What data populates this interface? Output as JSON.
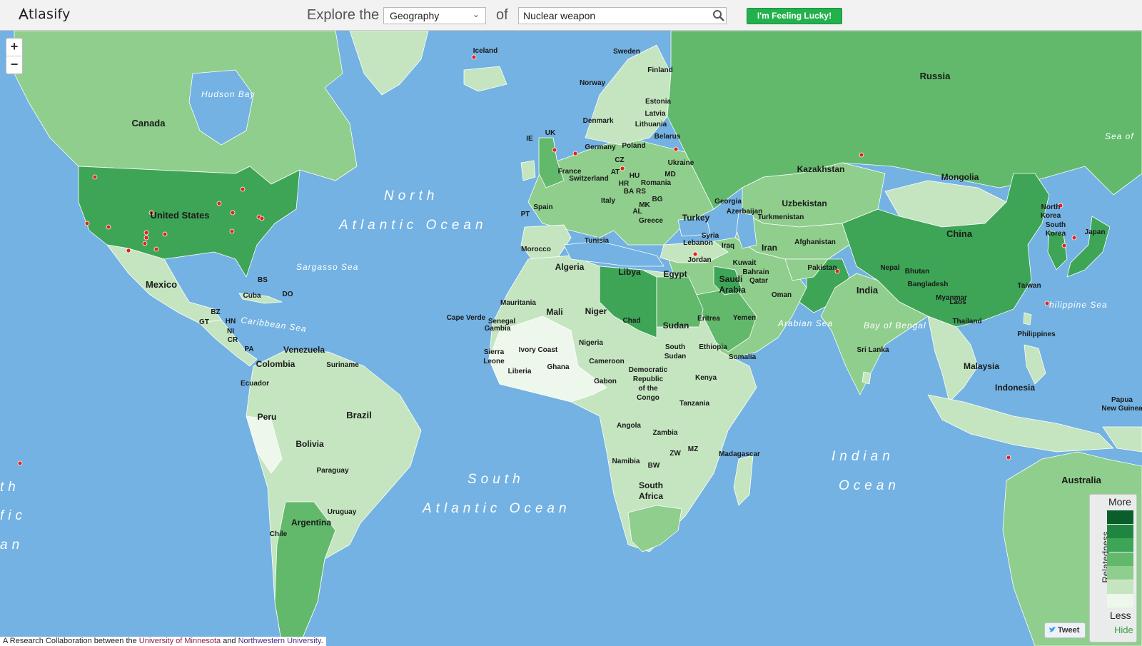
{
  "app": {
    "logo_text": "tlasify"
  },
  "header": {
    "explore_label": "Explore the",
    "category_selected": "Geography",
    "of_label": "of",
    "search_value": "Nuclear weapon",
    "lucky_label": "I'm Feeling Lucky!"
  },
  "zoom": {
    "in_label": "+",
    "out_label": "−"
  },
  "legend": {
    "more_label": "More",
    "less_label": "Less",
    "title": "Relatedness",
    "hide_label": "Hide",
    "colors": [
      "#0b5e2b",
      "#1f8641",
      "#3ea557",
      "#62b96c",
      "#8fce8c",
      "#c4e5c0",
      "#eef7ec"
    ]
  },
  "tweet": {
    "label": "Tweet"
  },
  "footer": {
    "prefix": "A Research Collaboration between the",
    "umn": "University of Minnesota",
    "and": "and",
    "nwu": "Northwestern University",
    "suffix": "."
  },
  "map": {
    "ocean_color": "#73b2e2",
    "oceans": {
      "north1": "North",
      "north2": "Atlantic Ocean",
      "south1": "South",
      "south2": "Atlantic Ocean",
      "indian1": "Indian",
      "indian2": "Ocean",
      "pac1": "th",
      "pac2": "fic",
      "pac3": "an",
      "hudson": "Hudson Bay",
      "sargasso": "Sargasso Sea",
      "caribbean": "Caribbean Sea",
      "arabian": "Arabian Sea",
      "bengal": "Bay of Bengal",
      "philippine": "hilippine Sea",
      "okhotsk": "Sea of"
    },
    "countries": {
      "canada": "Canada",
      "us": "United States",
      "mexico": "Mexico",
      "russia": "Russia",
      "china": "China",
      "mongolia": "Mongolia",
      "kazakhstan": "Kazakhstan",
      "uzbekistan": "Uzbekistan",
      "turkmenistan": "Turkmenistan",
      "afghanistan": "Afghanistan",
      "pakistan": "Pakistan",
      "iran": "Iran",
      "iraq": "Iraq",
      "syria": "Syria",
      "lebanon": "Lebanon",
      "jordan": "Jordan",
      "kuwait": "Kuwait",
      "bahrain": "Bahrain",
      "qatar": "Qatar",
      "saudi1": "Saudi",
      "saudi2": "Arabia",
      "oman": "Oman",
      "yemen": "Yemen",
      "india": "India",
      "nepal": "Nepal",
      "bhutan": "Bhutan",
      "bangladesh": "Bangladesh",
      "myanmar": "Myanmar",
      "laos": "Laos",
      "thailand": "Thailand",
      "srilanka": "Sri Lanka",
      "malaysia": "Malaysia",
      "indonesia": "Indonesia",
      "philippines": "Philippines",
      "taiwan": "Taiwan",
      "japan": "Japan",
      "nk1": "North",
      "nk2": "Korea",
      "sk1": "South",
      "sk2": "Korea",
      "png1": "Papua",
      "png2": "New Guinea",
      "australia": "Australia",
      "turkey": "Turkey",
      "georgia": "Georgia",
      "azerbaijan": "Azerbaijan",
      "greece": "Greece",
      "egypt": "Egypt",
      "libya": "Libya",
      "tunisia": "Tunisia",
      "algeria": "Algeria",
      "morocco": "Morocco",
      "mauritania": "Mauritania",
      "mali": "Mali",
      "niger": "Niger",
      "chad": "Chad",
      "sudan": "Sudan",
      "eritrea": "Eritrea",
      "ethiopia": "Ethiopia",
      "somalia": "Somalia",
      "ssudan1": "South",
      "ssudan2": "Sudan",
      "kenya": "Kenya",
      "tanzania": "Tanzania",
      "drc1": "Democratic",
      "drc2": "Republic",
      "drc3": "of the",
      "drc4": "Congo",
      "gabon": "Gabon",
      "cameroon": "Cameroon",
      "nigeria": "Nigeria",
      "ghana": "Ghana",
      "ivory": "Ivory Coast",
      "liberia": "Liberia",
      "sierra1": "Sierra",
      "sierra2": "Leone",
      "senegal": "Senegal",
      "gambia": "Gambia",
      "capeverde": "Cape Verde",
      "angola": "Angola",
      "zambia": "Zambia",
      "zw": "ZW",
      "mz": "MZ",
      "namibia": "Namibia",
      "bw": "BW",
      "sa1": "South",
      "sa2": "Africa",
      "madagascar": "Madagascar",
      "iceland": "Iceland",
      "sweden": "Sweden",
      "finland": "Finland",
      "norway": "Norway",
      "estonia": "Estonia",
      "latvia": "Latvia",
      "lithuania": "Lithuania",
      "belarus": "Belarus",
      "denmark": "Denmark",
      "poland": "Poland",
      "germany": "Germany",
      "uk": "UK",
      "ie": "IE",
      "france": "France",
      "switzerland": "Switzerland",
      "cz": "CZ",
      "at": "AT",
      "hu": "HU",
      "md": "MD",
      "romania": "Romania",
      "hr": "HR",
      "ba": "BA",
      "rs": "RS",
      "bg": "BG",
      "mk": "MK",
      "al": "AL",
      "italy": "Italy",
      "spain": "Spain",
      "pt": "PT",
      "ukraine": "Ukraine",
      "bs": "BS",
      "cuba": "Cuba",
      "do": "DO",
      "bz": "BZ",
      "gt": "GT",
      "hn": "HN",
      "ni": "NI",
      "cr": "CR",
      "pa": "PA",
      "venezuela": "Venezuela",
      "suriname": "Suriname",
      "colombia": "Colombia",
      "ecuador": "Ecuador",
      "peru": "Peru",
      "brazil": "Brazil",
      "bolivia": "Bolivia",
      "paraguay": "Paraguay",
      "uruguay": "Uruguay",
      "argentina": "Argentina",
      "chile": "Chile"
    }
  }
}
